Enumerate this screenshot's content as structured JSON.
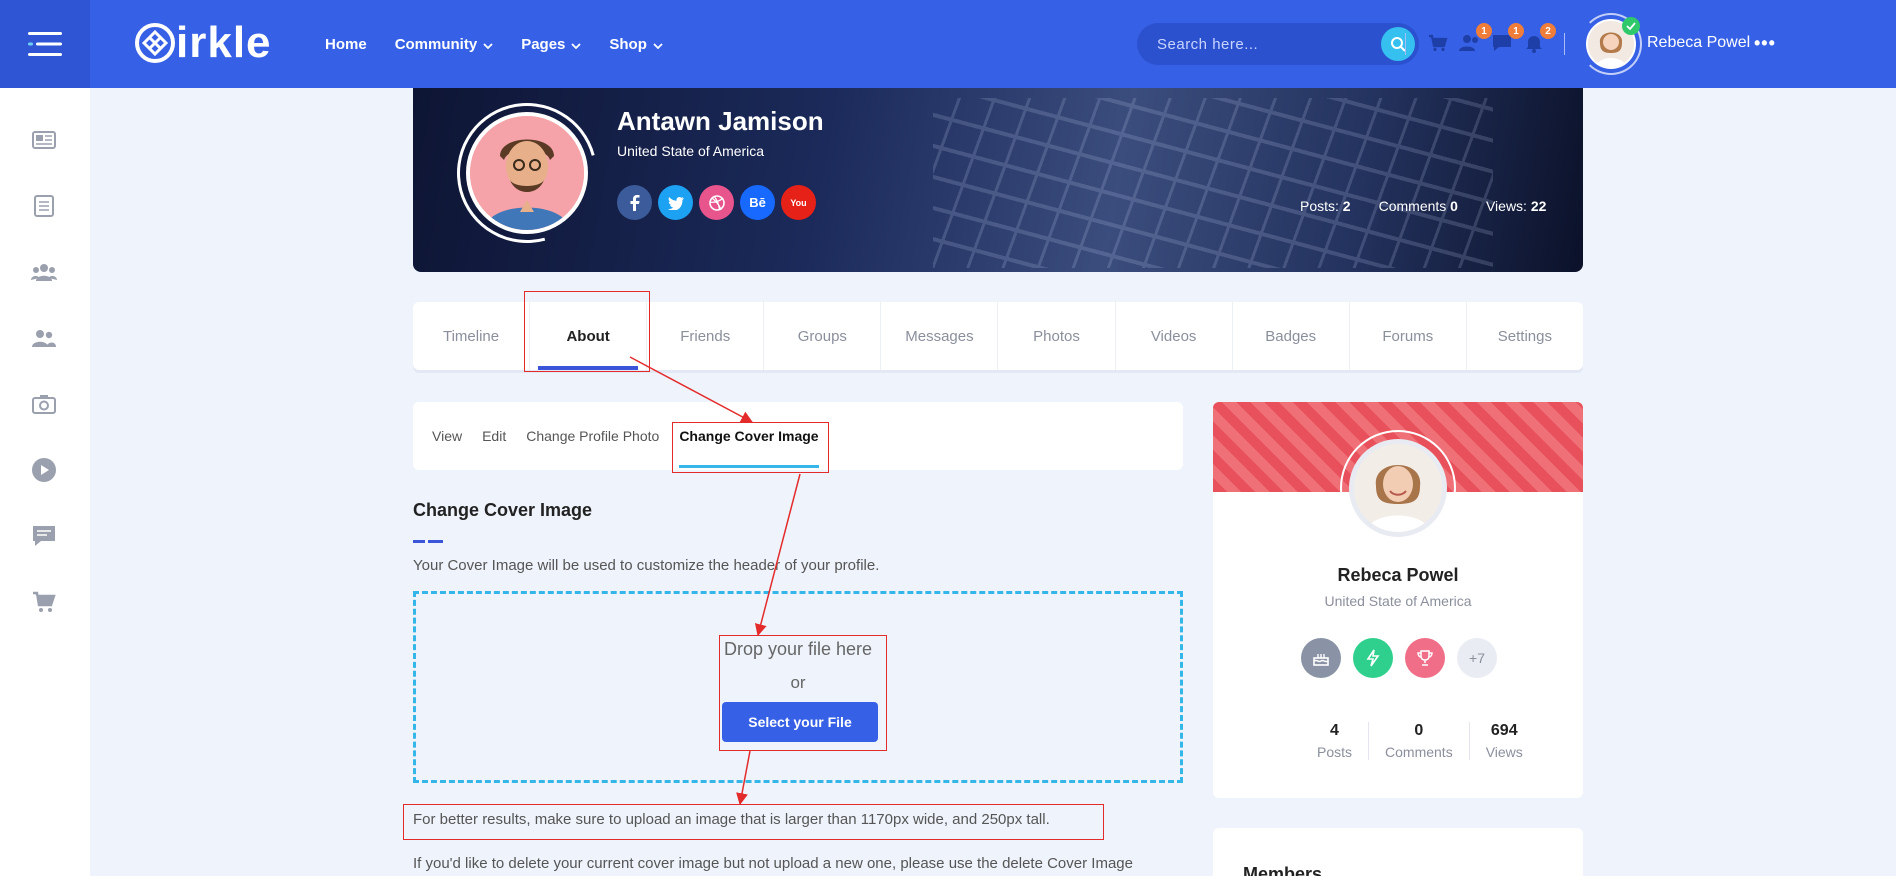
{
  "header": {
    "logo_text": "irkle",
    "nav": [
      {
        "label": "Home",
        "has_dropdown": false
      },
      {
        "label": "Community",
        "has_dropdown": true
      },
      {
        "label": "Pages",
        "has_dropdown": true
      },
      {
        "label": "Shop",
        "has_dropdown": true
      }
    ],
    "search_placeholder": "Search here...",
    "badges": {
      "friends": "1",
      "messages": "1",
      "notifications": "2"
    },
    "user_name": "Rebeca Powel"
  },
  "profile": {
    "name": "Antawn Jamison",
    "location": "United State of America",
    "stats": {
      "posts_label": "Posts:",
      "posts_value": "2",
      "comments_label": "Comments",
      "comments_value": "0",
      "views_label": "Views:",
      "views_value": "22"
    },
    "social": [
      "facebook",
      "twitter",
      "dribbble",
      "behance",
      "youtube"
    ],
    "behance_label": "Bē",
    "youtube_label": "You"
  },
  "tabs": [
    "Timeline",
    "About",
    "Friends",
    "Groups",
    "Messages",
    "Photos",
    "Videos",
    "Badges",
    "Forums",
    "Settings"
  ],
  "active_tab": "About",
  "subnav": [
    "View",
    "Edit",
    "Change Profile Photo",
    "Change Cover Image"
  ],
  "active_subnav": "Change Cover Image",
  "content": {
    "title": "Change Cover Image",
    "intro": "Your Cover Image will be used to customize the header of your profile.",
    "drop_text": "Drop your file here",
    "or_text": "or",
    "select_button": "Select your File",
    "hint": "For better results, make sure to upload an image that is larger than 1170px wide, and 250px tall.",
    "delete_note": "If you'd like to delete your current cover image but not upload a new one, please use the delete Cover Image"
  },
  "sidecard": {
    "name": "Rebeca Powel",
    "location": "United State of America",
    "more_badges": "+7",
    "stats": [
      {
        "value": "4",
        "label": "Posts"
      },
      {
        "value": "0",
        "label": "Comments"
      },
      {
        "value": "694",
        "label": "Views"
      }
    ],
    "members_title": "Members"
  },
  "colors": {
    "primary": "#3660e6",
    "accent": "#35b6e8",
    "annotation": "#e32b2b"
  }
}
